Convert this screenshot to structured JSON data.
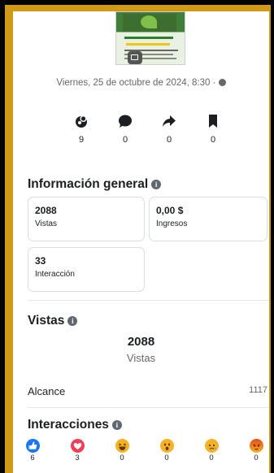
{
  "post": {
    "date": "Viernes, 25 de octubre de 2024, 8:30 ·",
    "thumbnail_icon": "image-post-thumbnail"
  },
  "stats": [
    {
      "icon": "reactions-icon",
      "value": "9"
    },
    {
      "icon": "comment-icon",
      "value": "0"
    },
    {
      "icon": "share-icon",
      "value": "0"
    },
    {
      "icon": "bookmark-icon",
      "value": "0"
    }
  ],
  "general": {
    "title": "Información general",
    "cards": [
      {
        "value": "2088",
        "label": "Vistas"
      },
      {
        "value": "0,00 $",
        "label": "Ingresos"
      },
      {
        "value": "33",
        "label": "Interacción"
      }
    ]
  },
  "vistas": {
    "title": "Vistas",
    "value": "2088",
    "label": "Vistas",
    "alcance_label": "Alcance",
    "alcance_value": "1117"
  },
  "interacciones": {
    "title": "Interacciones",
    "reactions": [
      {
        "name": "like",
        "color": "#1877f2",
        "value": "6"
      },
      {
        "name": "love",
        "color": "#f33e58",
        "value": "3"
      },
      {
        "name": "haha",
        "color": "#f7b125",
        "value": "0"
      },
      {
        "name": "wow",
        "color": "#f7b125",
        "value": "0"
      },
      {
        "name": "sad",
        "color": "#f7b125",
        "value": "0"
      },
      {
        "name": "angry",
        "color": "#e9710f",
        "value": "0"
      }
    ]
  }
}
